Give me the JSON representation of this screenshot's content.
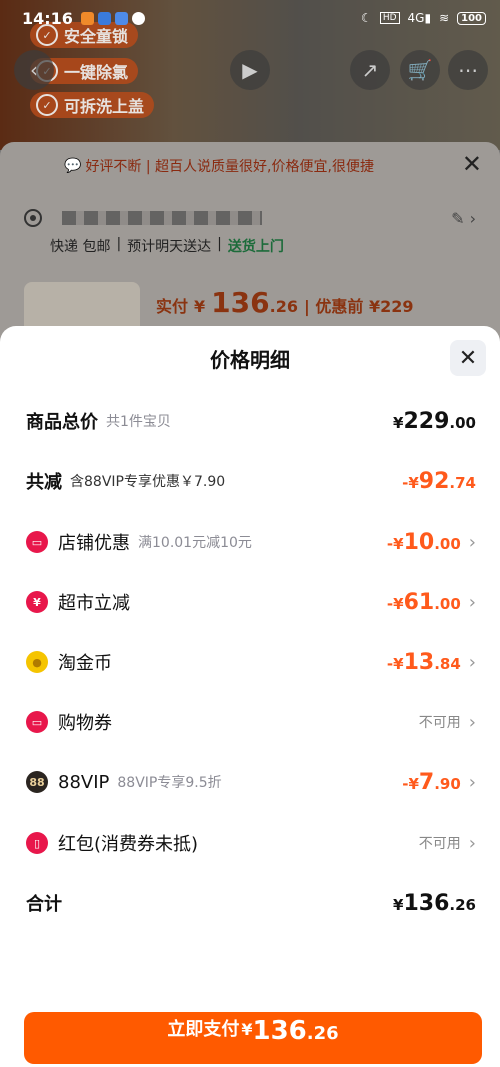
{
  "status_bar": {
    "time": "14:16",
    "network": "4G",
    "battery": "100"
  },
  "background": {
    "promo_tags": [
      "安全童锁",
      "一键除氯",
      "可拆洗上盖"
    ],
    "notice": "好评不断 | 超百人说质量很好,价格便宜,很便捷",
    "shipping": {
      "express": "快递 包邮",
      "eta": "预计明天送达",
      "delivery": "送货上门"
    },
    "price_line": {
      "actual_label": "实付",
      "currency": "¥",
      "actual_int": "136",
      "actual_dec": ".26",
      "before_label": "| 优惠前 ¥229"
    }
  },
  "sheet": {
    "title": "价格明细",
    "rows": [
      {
        "label": "商品总价",
        "desc": "共1件宝贝",
        "currency": "¥",
        "int": "229",
        "dec": ".00"
      },
      {
        "label": "共减",
        "desc": "含88VIP专享优惠￥7.90",
        "currency": "-¥",
        "int": "92",
        "dec": ".74"
      },
      {
        "label": "店铺优惠",
        "desc": "满10.01元减10元",
        "currency": "-¥",
        "int": "10",
        "dec": ".00"
      },
      {
        "label": "超市立减",
        "currency": "-¥",
        "int": "61",
        "dec": ".00"
      },
      {
        "label": "淘金币",
        "currency": "-¥",
        "int": "13",
        "dec": ".84"
      },
      {
        "label": "购物券",
        "status": "不可用"
      },
      {
        "label": "88VIP",
        "desc": "88VIP专享9.5折",
        "currency": "-¥",
        "int": "7",
        "dec": ".90"
      },
      {
        "label": "红包(消费券未抵)",
        "status": "不可用"
      },
      {
        "label": "合计",
        "currency": "¥",
        "int": "136",
        "dec": ".26"
      }
    ],
    "pay_button": {
      "label": "立即支付",
      "currency": "¥",
      "int": "136",
      "dec": ".26"
    }
  },
  "colors": {
    "accent": "#ff5a00",
    "discount": "#ff5a1c"
  }
}
